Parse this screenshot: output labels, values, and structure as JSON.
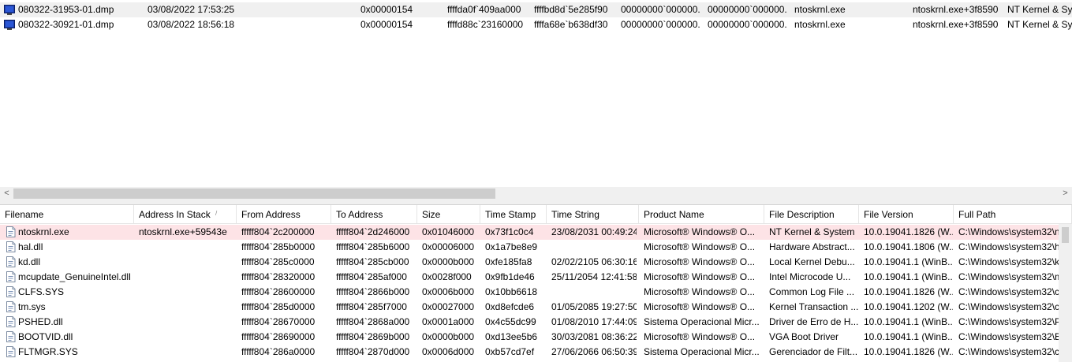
{
  "crash_list": {
    "rows": [
      {
        "icon": "dump-file-icon",
        "cells": [
          "080322-31953-01.dmp",
          "03/08/2022 17:53:25",
          "0x00000154",
          "ffffda0f`409aa000",
          "ffffbd8d`5e285f90",
          "00000000`000000...",
          "00000000`000000...",
          "ntoskrnl.exe",
          "ntoskrnl.exe+3f8590",
          "NT Kernel & Sys"
        ]
      },
      {
        "icon": "dump-file-icon",
        "cells": [
          "080322-30921-01.dmp",
          "03/08/2022 18:56:18",
          "0x00000154",
          "ffffd88c`23160000",
          "ffffa68e`b638df30",
          "00000000`000000...",
          "00000000`000000...",
          "ntoskrnl.exe",
          "ntoskrnl.exe+3f8590",
          "NT Kernel & Sys"
        ]
      }
    ]
  },
  "scrollbar": {
    "left_arrow": "<",
    "right_arrow": ">"
  },
  "modules": {
    "columns": [
      "Filename",
      "Address In Stack",
      "From Address",
      "To Address",
      "Size",
      "Time Stamp",
      "Time String",
      "Product Name",
      "File Description",
      "File Version",
      "Full Path"
    ],
    "sort_indicator": "/",
    "rows": [
      [
        "ntoskrnl.exe",
        "ntoskrnl.exe+59543e",
        "fffff804`2c200000",
        "fffff804`2d246000",
        "0x01046000",
        "0x73f1c0c4",
        "23/08/2031 00:49:24",
        "Microsoft® Windows® O...",
        "NT Kernel & System",
        "10.0.19041.1826 (W...",
        "C:\\Windows\\system32\\n"
      ],
      [
        "hal.dll",
        "",
        "fffff804`285b0000",
        "fffff804`285b6000",
        "0x00006000",
        "0x1a7be8e9",
        "",
        "Microsoft® Windows® O...",
        "Hardware Abstract...",
        "10.0.19041.1806 (W...",
        "C:\\Windows\\system32\\h"
      ],
      [
        "kd.dll",
        "",
        "fffff804`285c0000",
        "fffff804`285cb000",
        "0x0000b000",
        "0xfe185fa8",
        "02/02/2105 06:30:16",
        "Microsoft® Windows® O...",
        "Local Kernel Debu...",
        "10.0.19041.1 (WinB...",
        "C:\\Windows\\system32\\k"
      ],
      [
        "mcupdate_GenuineIntel.dll",
        "",
        "fffff804`28320000",
        "fffff804`285af000",
        "0x0028f000",
        "0x9fb1de46",
        "25/11/2054 12:41:58",
        "Microsoft® Windows® O...",
        "Intel Microcode U...",
        "10.0.19041.1 (WinB...",
        "C:\\Windows\\system32\\m"
      ],
      [
        "CLFS.SYS",
        "",
        "fffff804`28600000",
        "fffff804`2866b000",
        "0x0006b000",
        "0x10bb6618",
        "",
        "Microsoft® Windows® O...",
        "Common Log File ...",
        "10.0.19041.1826 (W...",
        "C:\\Windows\\system32\\c"
      ],
      [
        "tm.sys",
        "",
        "fffff804`285d0000",
        "fffff804`285f7000",
        "0x00027000",
        "0xd8efcde6",
        "01/05/2085 19:27:50",
        "Microsoft® Windows® O...",
        "Kernel Transaction ...",
        "10.0.19041.1202 (W...",
        "C:\\Windows\\system32\\c"
      ],
      [
        "PSHED.dll",
        "",
        "fffff804`28670000",
        "fffff804`2868a000",
        "0x0001a000",
        "0x4c55dc99",
        "01/08/2010 17:44:09",
        "Sistema Operacional Micr...",
        "Driver de Erro de H...",
        "10.0.19041.1 (WinB...",
        "C:\\Windows\\system32\\P"
      ],
      [
        "BOOTVID.dll",
        "",
        "fffff804`28690000",
        "fffff804`2869b000",
        "0x0000b000",
        "0xd13ee5b6",
        "30/03/2081 08:36:22",
        "Microsoft® Windows® O...",
        "VGA Boot Driver",
        "10.0.19041.1 (WinB...",
        "C:\\Windows\\system32\\B"
      ],
      [
        "FLTMGR.SYS",
        "",
        "fffff804`286a0000",
        "fffff804`2870d000",
        "0x0006d000",
        "0xb57cd7ef",
        "27/06/2066 06:50:39",
        "Sistema Operacional Micr...",
        "Gerenciador de Filt...",
        "10.0.19041.1826 (W...",
        "C:\\Windows\\system32\\c"
      ]
    ]
  }
}
